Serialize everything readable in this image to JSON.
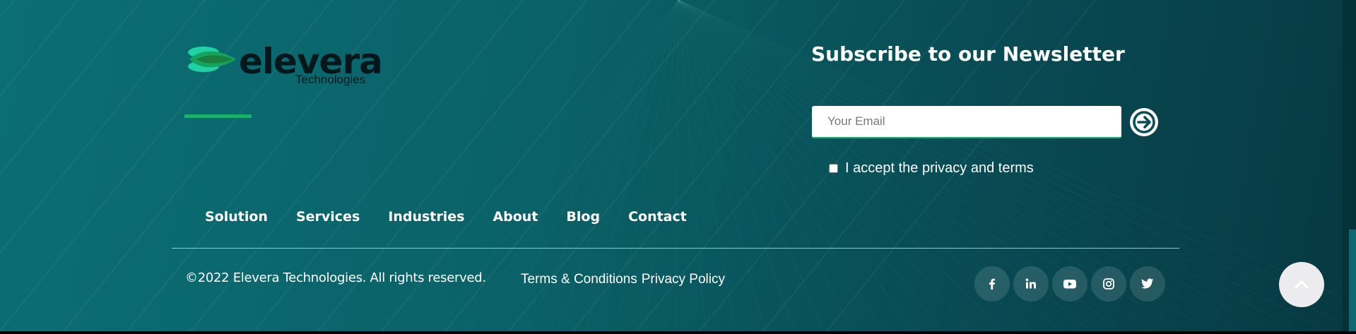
{
  "brand": {
    "name": "elevera",
    "tagline": "Technologies"
  },
  "newsletter": {
    "title": "Subscribe to our Newsletter",
    "email_placeholder": "Your Email",
    "email_value": "",
    "submit_icon": "arrow-right-circle-icon",
    "consent_label": "I accept the privacy and terms",
    "consent_checked": false
  },
  "nav": {
    "items": [
      {
        "label": "Solution"
      },
      {
        "label": "Services"
      },
      {
        "label": "Industries"
      },
      {
        "label": "About"
      },
      {
        "label": "Blog"
      },
      {
        "label": "Contact"
      }
    ]
  },
  "bottom": {
    "copyright": "©2022 Elevera Technologies. All rights reserved.",
    "terms_label": "Terms & Conditions",
    "privacy_label": "Privacy Policy"
  },
  "social": {
    "icons": [
      "facebook-icon",
      "linkedin-icon",
      "youtube-icon",
      "instagram-icon",
      "twitter-icon"
    ]
  },
  "scroll_top": {
    "icon": "chevron-up-icon"
  },
  "colors": {
    "background_start": "#0b6e74",
    "background_end": "#073942",
    "accent": "#19b06c",
    "text": "#ffffff",
    "logo_text": "#05171a"
  }
}
